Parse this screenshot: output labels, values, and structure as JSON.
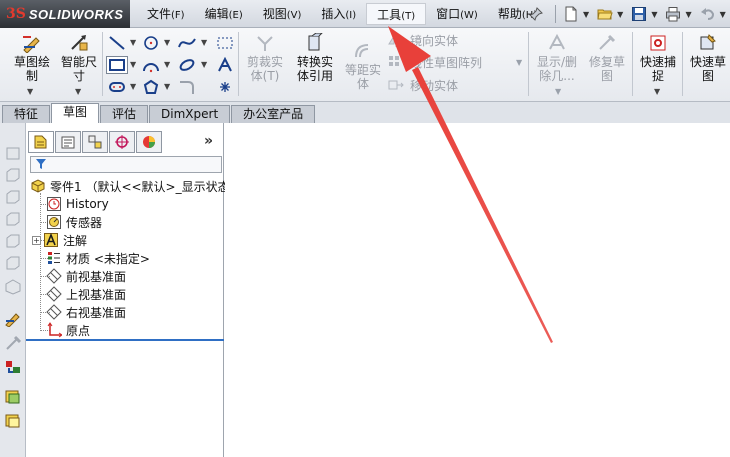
{
  "app": {
    "logo_mark": "3S",
    "logo_text": "SOLIDWORKS"
  },
  "menu": [
    {
      "label": "文件",
      "acc": "(F)"
    },
    {
      "label": "编辑",
      "acc": "(E)"
    },
    {
      "label": "视图",
      "acc": "(V)"
    },
    {
      "label": "插入",
      "acc": "(I)"
    },
    {
      "label": "工具",
      "acc": "(T)"
    },
    {
      "label": "窗口",
      "acc": "(W)"
    },
    {
      "label": "帮助",
      "acc": "(H)"
    }
  ],
  "quick_access": [
    "pin-icon",
    "new-document-icon",
    "open-folder-icon",
    "save-icon",
    "print-icon",
    "undo-icon"
  ],
  "commands": {
    "sketch": "草图绘\n制",
    "smart_dim": "智能尺\n寸",
    "trim": "剪裁实\n体(T)",
    "convert": "转换实\n体引用",
    "offset": "等距实\n体",
    "mirror": "镜向实体",
    "linear_pattern": "线性草图阵列",
    "move": "移动实体",
    "display_delete": "显示/删\n除几...",
    "repair": "修复草\n图",
    "quick_snap": "快速捕\n捉",
    "quick_sketch": "快速草\n图"
  },
  "tabs": [
    "特征",
    "草图",
    "评估",
    "DimXpert",
    "办公室产品"
  ],
  "active_tab": "草图",
  "tree": {
    "root": "零件1 （默认<<默认>_显示状态",
    "history": "History",
    "sensors": "传感器",
    "annotations": "注解",
    "material": "材质 <未指定>",
    "front_plane": "前视基准面",
    "top_plane": "上视基准面",
    "right_plane": "右视基准面",
    "origin": "原点"
  },
  "fm_more": "»",
  "colors": {
    "annotation_arrow": "#e8403a",
    "accent_blue": "#2f6fc4",
    "logo_bg": "#2c2f34"
  }
}
